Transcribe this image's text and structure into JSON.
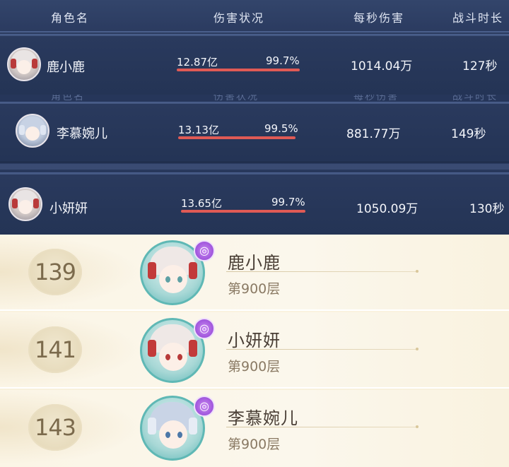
{
  "header": {
    "col_name": "角色名",
    "col_damage": "伤害状况",
    "col_dps": "每秒伤害",
    "col_duration": "战斗时长"
  },
  "battle_rows": [
    {
      "name": "鹿小鹿",
      "damage": "12.87亿",
      "percent": "99.7%",
      "percent_value": 99.7,
      "dps": "1014.04万",
      "duration": "127秒"
    },
    {
      "name": "李慕婉儿",
      "damage": "13.13亿",
      "percent": "99.5%",
      "percent_value": 99.5,
      "dps": "881.77万",
      "duration": "149秒"
    },
    {
      "name": "小妍妍",
      "damage": "13.65亿",
      "percent": "99.7%",
      "percent_value": 99.7,
      "dps": "1050.09万",
      "duration": "130秒"
    }
  ],
  "ranking": [
    {
      "rank": "139",
      "name": "鹿小鹿",
      "floor": "第900层"
    },
    {
      "rank": "141",
      "name": "小妍妍",
      "floor": "第900层"
    },
    {
      "rank": "143",
      "name": "李慕婉儿",
      "floor": "第900层"
    }
  ],
  "colors": {
    "dark_bg": "#27375a",
    "damage_bar": "#e05a55",
    "light_bg": "#fbf5e6",
    "rank_text": "#7b6a4c",
    "badge_purple": "#8e3ed4"
  }
}
